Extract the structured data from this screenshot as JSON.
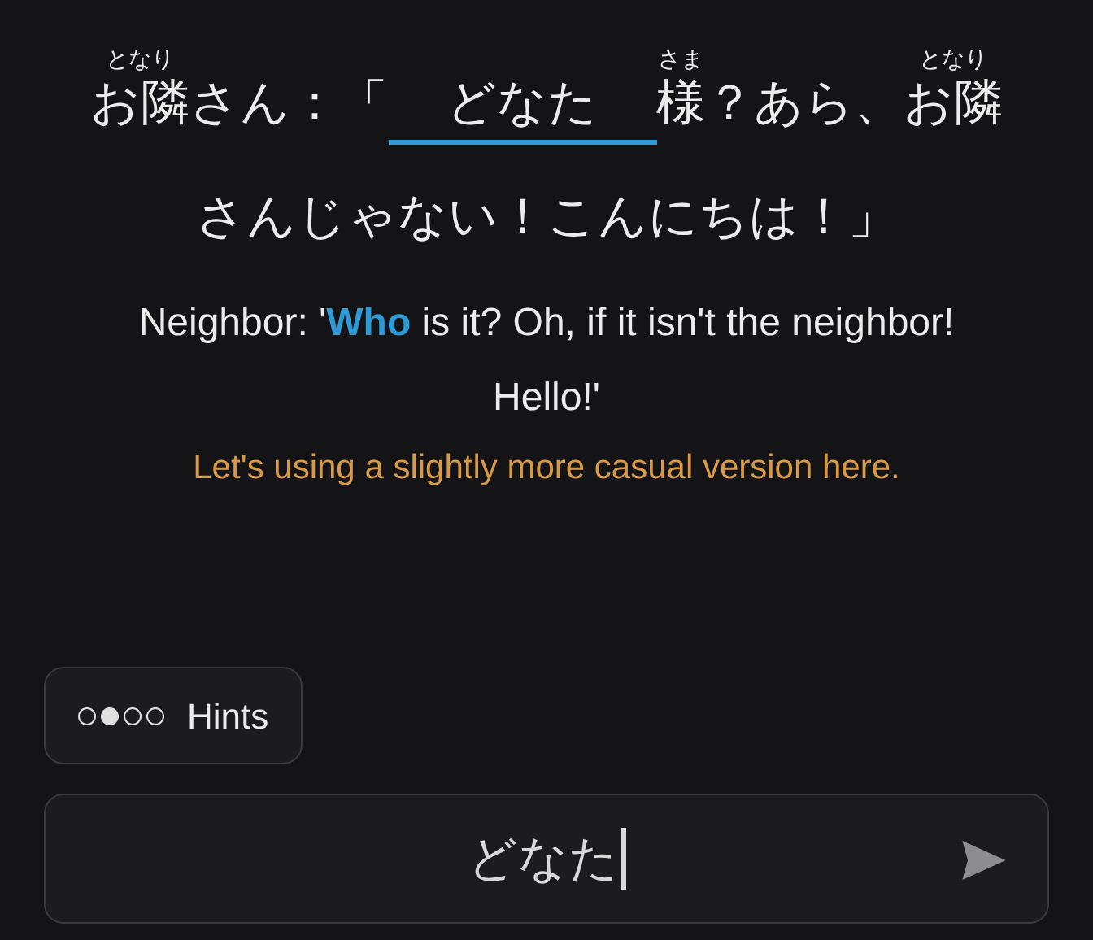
{
  "sentence": {
    "lines": [
      [
        {
          "text": "お隣",
          "ruby": "となり"
        },
        {
          "text": "さん：「"
        },
        {
          "kind": "blank",
          "text": "どなた"
        },
        {
          "text": "様",
          "ruby": "さま"
        },
        {
          "text": "？あら、"
        },
        {
          "text": "お隣",
          "ruby": "となり"
        }
      ],
      [
        {
          "text": "さんじゃない！こんにちは！」"
        }
      ]
    ]
  },
  "translation": "Neighbor: '**Who** is it? Oh, if it isn't the neighbor! Hello!'",
  "note": "Let's using a slightly more casual version here.",
  "hints": {
    "label": "Hints",
    "dots": [
      {
        "filled": false
      },
      {
        "filled": true
      },
      {
        "filled": false
      },
      {
        "filled": false
      }
    ]
  },
  "answer": {
    "value": "どなた"
  }
}
